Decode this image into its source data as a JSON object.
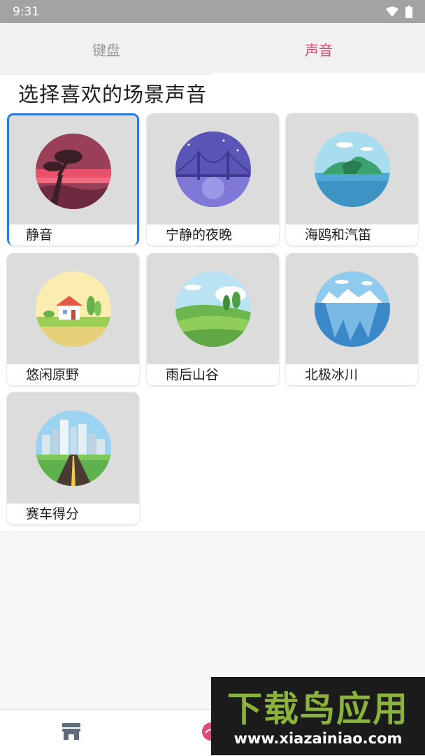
{
  "status_bar": {
    "time": "9:31",
    "icons": [
      "wifi-icon",
      "battery-icon"
    ]
  },
  "tabs": [
    {
      "label": "键盘",
      "active": false
    },
    {
      "label": "声音",
      "active": true
    }
  ],
  "section_title": "选择喜欢的场景声音",
  "scenes": [
    {
      "label": "静音",
      "icon": "bonsai-sunset-icon",
      "selected": true
    },
    {
      "label": "宁静的夜晚",
      "icon": "bridge-night-icon",
      "selected": false
    },
    {
      "label": "海鸥和汽笛",
      "icon": "island-sea-icon",
      "selected": false
    },
    {
      "label": "悠闲原野",
      "icon": "countryside-house-icon",
      "selected": false
    },
    {
      "label": "雨后山谷",
      "icon": "green-valley-icon",
      "selected": false
    },
    {
      "label": "北极冰川",
      "icon": "glacier-icon",
      "selected": false
    },
    {
      "label": "赛车得分",
      "icon": "city-road-icon",
      "selected": false
    }
  ],
  "bottom_nav": {
    "items": [
      "store-icon",
      "sound-icon"
    ]
  },
  "watermark": {
    "brand": "下载鸟应用",
    "url": "www.xiazainiao.com"
  },
  "colors": {
    "accent": "#d64a75",
    "selected_border": "#2b7bd6",
    "status_bar": "#a3a3a3"
  }
}
